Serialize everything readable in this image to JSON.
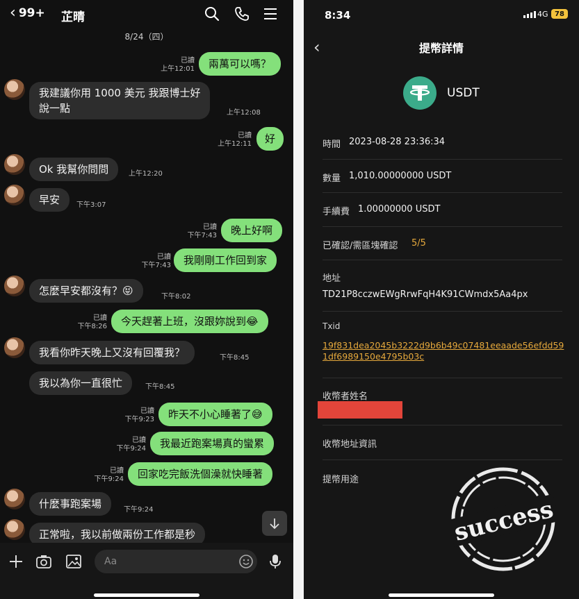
{
  "chat": {
    "back_count": "99+",
    "contact_name": "芷晴",
    "date_separator": "8/24（四）",
    "input_placeholder": "Aa",
    "messages": [
      {
        "dir": "out",
        "text": "兩萬可以嗎？",
        "read": "已讀",
        "time": "上午12:01"
      },
      {
        "dir": "in",
        "text1": "我建議你用 1000 美元 我跟博士好",
        "text2": "說一點",
        "time": "上午12:08"
      },
      {
        "dir": "out",
        "text": "好",
        "read": "已讀",
        "time": "上午12:11"
      },
      {
        "dir": "in",
        "text": "Ok 我幫你問問",
        "time": "上午12:20"
      },
      {
        "dir": "in",
        "text": "早安",
        "time": "下午3:07"
      },
      {
        "dir": "out",
        "text": "晚上好啊",
        "read": "已讀",
        "time": "下午7:43"
      },
      {
        "dir": "out",
        "text": "我剛剛工作回到家",
        "read": "已讀",
        "time": "下午7:43"
      },
      {
        "dir": "in",
        "text": "怎麼早安都沒有？😝",
        "time": "下午8:02"
      },
      {
        "dir": "out",
        "text": "今天趕著上班，沒跟妳說到😂",
        "read": "已讀",
        "time": "下午8:26"
      },
      {
        "dir": "in",
        "text": "我看你昨天晚上又沒有回覆我？",
        "time": "下午8:45"
      },
      {
        "dir": "in",
        "text": "我以為你一直很忙",
        "time": "下午8:45"
      },
      {
        "dir": "out",
        "text": "昨天不小心睡著了😅",
        "read": "已讀",
        "time": "下午9:23"
      },
      {
        "dir": "out",
        "text": "我最近跑案場真的蠻累",
        "read": "已讀",
        "time": "下午9:24"
      },
      {
        "dir": "out",
        "text": "回家吃完飯洗個澡就快睡著",
        "read": "已讀",
        "time": "下午9:24"
      },
      {
        "dir": "in",
        "text": "什麼事跑案場",
        "time": "下午9:24"
      },
      {
        "dir": "in",
        "text": "正常啦，我以前做兩份工作都是秒"
      }
    ]
  },
  "detail": {
    "status_time": "8:34",
    "network": "4G",
    "battery": "78",
    "title": "提幣詳情",
    "coin": "USDT",
    "time_label": "時間",
    "time_value": "2023-08-28 23:36:34",
    "amount_label": "數量",
    "amount_value": "1,010.00000000 USDT",
    "fee_label": "手續費",
    "fee_value": "1.00000000 USDT",
    "confirm_label": "已確認/需區塊確認",
    "confirm_value": "5/5",
    "address_label": "地址",
    "address_value": "TD21P8cczwEWgRrwFqH4K91CWmdx5Aa4px",
    "txid_label": "Txid",
    "txid_value": "19f831dea2045b3222d9b6b49c07481eeaade56efdd591df6989150e4795b03c",
    "receiver_name_label": "收幣者姓名",
    "receiver_address_label": "收幣地址資訊",
    "purpose_label": "提幣用途",
    "stamp_text": "success"
  },
  "colors": {
    "outgoing_bubble": "#84e07b",
    "incoming_bubble": "#2d2d2d",
    "txid_link": "#e6a93c",
    "confirm_value": "#e6a93c",
    "redaction": "#e3453a",
    "usdt_green": "#3bab8a"
  },
  "icons": [
    "chevron-left-icon",
    "search-icon",
    "phone-icon",
    "menu-icon",
    "plus-icon",
    "camera-icon",
    "image-icon",
    "emoji-icon",
    "microphone-icon",
    "arrow-down-icon",
    "tether-logo-icon",
    "success-stamp-icon"
  ]
}
